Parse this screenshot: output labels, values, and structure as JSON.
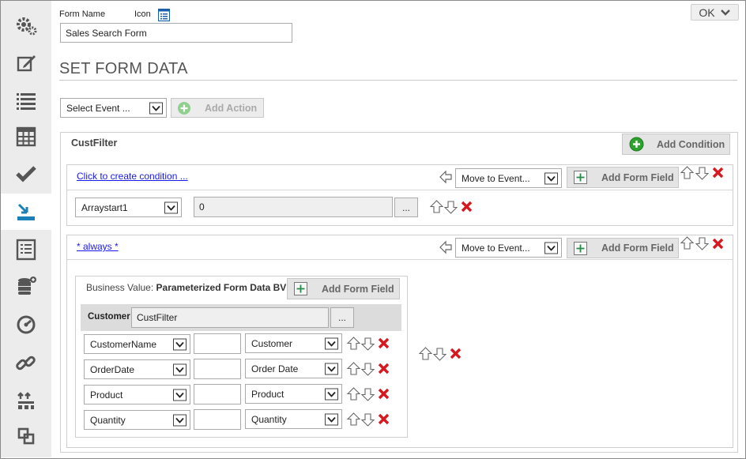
{
  "sidebar": {
    "items": [
      {
        "icon": "gears-icon"
      },
      {
        "icon": "edit-icon"
      },
      {
        "icon": "list-icon"
      },
      {
        "icon": "grid-icon"
      },
      {
        "icon": "check-icon"
      },
      {
        "icon": "import-icon",
        "active": true
      },
      {
        "icon": "form-list-icon"
      },
      {
        "icon": "database-add-icon"
      },
      {
        "icon": "dashboard-icon"
      },
      {
        "icon": "link-icon"
      },
      {
        "icon": "hierarchy-icon"
      },
      {
        "icon": "layers-icon"
      }
    ]
  },
  "header": {
    "form_name_label": "Form Name",
    "icon_label": "Icon",
    "form_name_value": "Sales Search Form",
    "ok_label": "OK"
  },
  "section_title": "SET FORM DATA",
  "event_select": {
    "value": "Select Event ...",
    "add_action_label": "Add Action"
  },
  "filter_panel": {
    "title": "CustFilter",
    "add_condition_label": "Add Condition",
    "condition1": {
      "link": "Click to create condition ...",
      "move_select": "Move to Event...",
      "add_form_field_label": "Add Form Field",
      "array_select": "Arraystart1",
      "array_value": "0",
      "ellipsis": "..."
    },
    "condition2": {
      "link": "* always *",
      "move_select": "Move to Event...",
      "add_form_field_label": "Add Form Field",
      "business_value_label": "Business Value:",
      "business_value_name": "Parameterized Form Data BV",
      "inner_add_form_field_label": "Add Form Field",
      "customer_label": "Customer",
      "customer_value": "CustFilter",
      "ellipsis": "...",
      "rows": [
        {
          "field": "CustomerName",
          "mapping": "Customer"
        },
        {
          "field": "OrderDate",
          "mapping": "Order Date"
        },
        {
          "field": "Product",
          "mapping": "Product"
        },
        {
          "field": "Quantity",
          "mapping": "Quantity"
        }
      ]
    }
  },
  "colors": {
    "delete": "#d8181e",
    "link": "#1a1aee",
    "add_green": "#2ea12e",
    "sidebar_icon": "#555555"
  }
}
